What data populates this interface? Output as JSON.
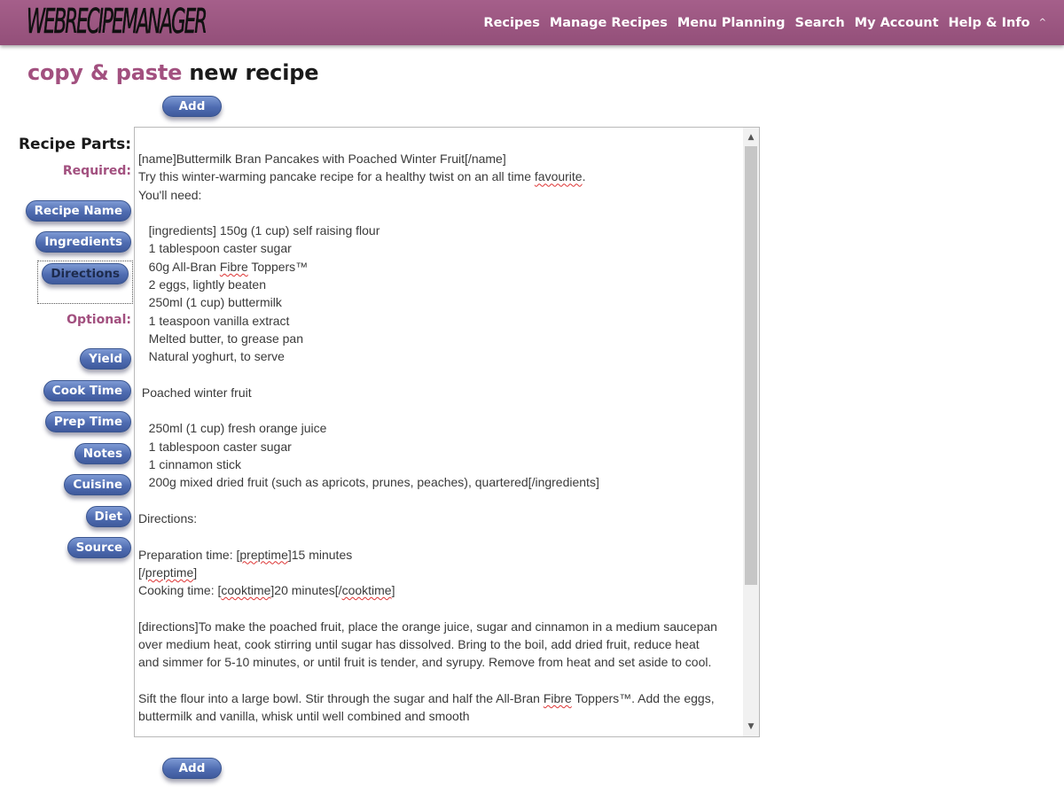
{
  "header": {
    "logo": "WEBRECIPEMANAGER",
    "nav": [
      "Recipes",
      "Manage Recipes",
      "Menu Planning",
      "Search",
      "My Account",
      "Help & Info"
    ],
    "caret": "^"
  },
  "page": {
    "title_accent": "copy & paste",
    "title_rest": "new recipe",
    "add_label": "Add"
  },
  "sidebar": {
    "heading": "Recipe Parts:",
    "required_label": "Required:",
    "required": [
      "Recipe Name",
      "Ingredients",
      "Directions"
    ],
    "optional_label": "Optional:",
    "optional": [
      "Yield",
      "Cook Time",
      "Prep Time",
      "Notes",
      "Cuisine",
      "Diet",
      "Source"
    ]
  },
  "editor": {
    "lines": [
      "[name]Buttermilk Bran Pancakes with Poached Winter Fruit[/name]",
      "Try this winter-warming pancake recipe for a healthy twist on an all time favourite.",
      "You'll need:",
      "",
      "   [ingredients] 150g (1 cup) self raising flour",
      "   1 tablespoon caster sugar",
      "   60g All-Bran Fibre Toppers™",
      "   2 eggs, lightly beaten",
      "   250ml (1 cup) buttermilk",
      "   1 teaspoon vanilla extract",
      "   Melted butter, to grease pan",
      "   Natural yoghurt, to serve",
      "",
      " Poached winter fruit",
      "",
      "   250ml (1 cup) fresh orange juice",
      "   1 tablespoon caster sugar",
      "   1 cinnamon stick",
      "   200g mixed dried fruit (such as apricots, prunes, peaches), quartered[/ingredients]",
      "",
      "Directions:",
      "",
      "Preparation time: [preptime]15 minutes",
      "[/preptime]",
      "Cooking time: [cooktime]20 minutes[/cooktime]",
      "",
      "[directions]To make the poached fruit, place the orange juice, sugar and cinnamon in a medium saucepan",
      "over medium heat, cook stirring until sugar has dissolved. Bring to the boil, add dried fruit, reduce heat",
      "and simmer for 5-10 minutes, or until fruit is tender, and syrupy. Remove from heat and set aside to cool.",
      "",
      "Sift the flour into a large bowl. Stir through the sugar and half the All-Bran Fibre Toppers™. Add the eggs,",
      "buttermilk and vanilla, whisk until well combined and smooth"
    ],
    "misspelled": [
      "favourite",
      "Fibre",
      "preptime",
      "cooktime"
    ]
  },
  "colors": {
    "header": "#9b5682",
    "accent": "#a2507f",
    "button": "#4f6cb1"
  },
  "icons": {
    "scroll_up": "scroll-up-arrow-icon",
    "scroll_down": "scroll-down-arrow-icon"
  }
}
